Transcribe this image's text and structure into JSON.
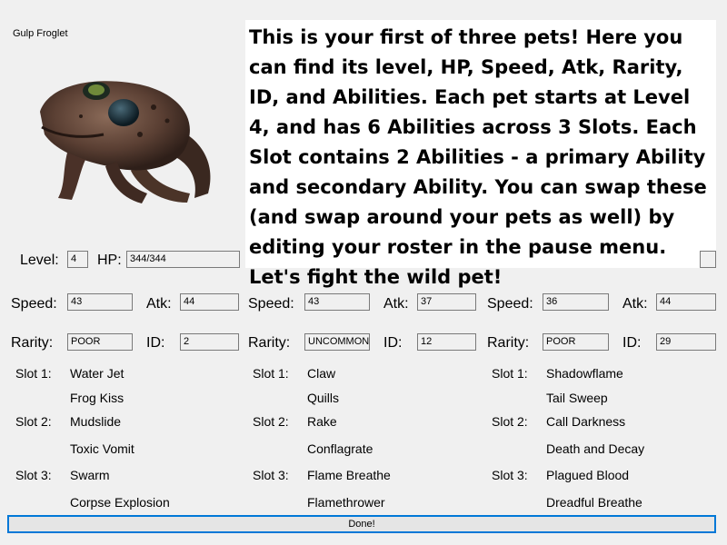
{
  "pet_name": "Gulp Froglet",
  "tutorial_text": "This is your first of three pets! Here you can find its level, HP, Speed, Atk, Rarity, ID, and Abilities. Each pet starts at Level 4, and has 6 Abilities across 3 Slots. Each Slot contains 2 Abilities - a primary Ability and secondary Ability. You can swap these (and swap around your pets as well) by editing your roster in the pause menu. Let's fight the wild pet!",
  "labels": {
    "level": "Level:",
    "hp": "HP:",
    "speed": "Speed:",
    "atk": "Atk:",
    "rarity": "Rarity:",
    "id": "ID:",
    "slot1": "Slot 1:",
    "slot2": "Slot 2:",
    "slot3": "Slot 3:"
  },
  "pet1_top": {
    "level": "4",
    "hp": "344/344"
  },
  "pets": [
    {
      "speed": "43",
      "atk": "44",
      "rarity": "POOR",
      "id": "2",
      "slot1": [
        "Water Jet",
        "Frog Kiss"
      ],
      "slot2": [
        "Mudslide",
        "Toxic Vomit"
      ],
      "slot3": [
        "Swarm",
        "Corpse Explosion"
      ]
    },
    {
      "speed": "43",
      "atk": "37",
      "rarity": "UNCOMMON",
      "id": "12",
      "slot1": [
        "Claw",
        "Quills"
      ],
      "slot2": [
        "Rake",
        "Conflagrate"
      ],
      "slot3": [
        "Flame Breathe",
        "Flamethrower"
      ]
    },
    {
      "speed": "36",
      "atk": "44",
      "rarity": "POOR",
      "id": "29",
      "slot1": [
        "Shadowflame",
        "Tail Sweep"
      ],
      "slot2": [
        "Call Darkness",
        "Death and Decay"
      ],
      "slot3": [
        "Plagued Blood",
        "Dreadful Breathe"
      ]
    }
  ],
  "done_label": "Done!"
}
